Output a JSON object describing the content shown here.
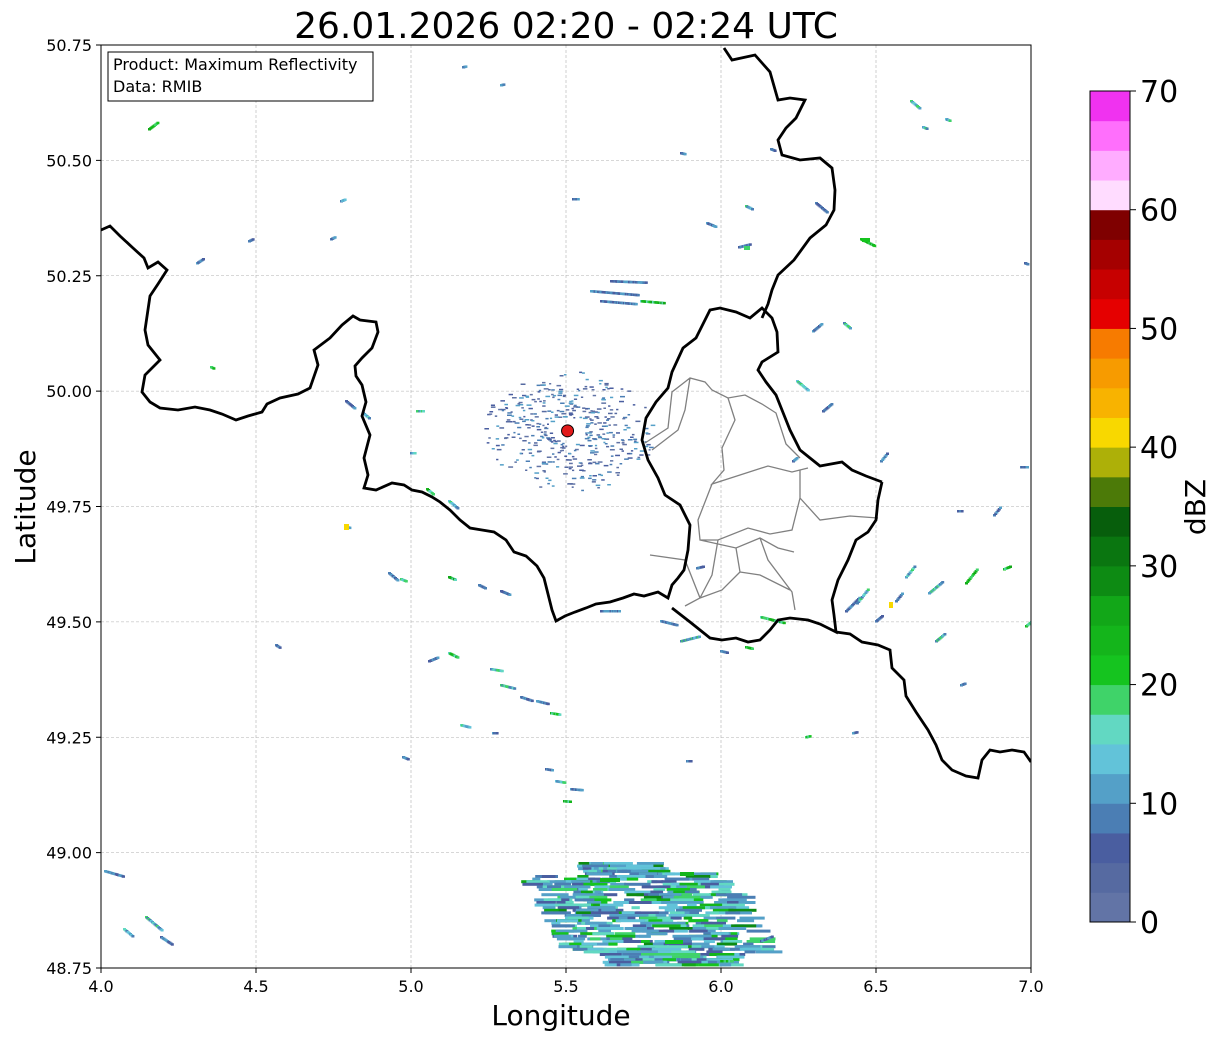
{
  "title": "26.01.2026 02:20 - 02:24 UTC",
  "info_box": {
    "product": "Product: Maximum Reflectivity",
    "source": "Data: RMIB"
  },
  "axes": {
    "xlabel": "Longitude",
    "ylabel": "Latitude",
    "xlim": [
      4.0,
      7.0
    ],
    "ylim": [
      48.75,
      50.75
    ],
    "xticks": [
      "4.0",
      "4.5",
      "5.0",
      "5.5",
      "6.0",
      "6.5",
      "7.0"
    ],
    "yticks": [
      "48.75",
      "49.00",
      "49.25",
      "49.50",
      "49.75",
      "50.00",
      "50.25",
      "50.50",
      "50.75"
    ],
    "grid": true
  },
  "colorbar": {
    "label": "dBZ",
    "range": [
      0,
      70
    ],
    "ticks": [
      "0",
      "10",
      "20",
      "30",
      "40",
      "50",
      "60",
      "70"
    ],
    "colors": [
      "#6274a6",
      "#566aa1",
      "#4a5ea0",
      "#4b7eb4",
      "#54a0c8",
      "#62c3d9",
      "#62d8c2",
      "#3fd369",
      "#15c41f",
      "#14b51b",
      "#12a718",
      "#0d8b13",
      "#0a7610",
      "#075e0c",
      "#4c7a08",
      "#adb008",
      "#f8d800",
      "#f8b300",
      "#f79b00",
      "#f77b00",
      "#e50000",
      "#c70000",
      "#a50000",
      "#7f0000",
      "#ffdcff",
      "#ffacff",
      "#ff6ffc",
      "#f032f0"
    ]
  },
  "station": {
    "lon": 5.505,
    "lat": 49.914,
    "color": "#e11b1b"
  },
  "map_colors": {
    "country_border": "#000000",
    "region_border": "#808080",
    "grid": "#b0b0b0"
  }
}
